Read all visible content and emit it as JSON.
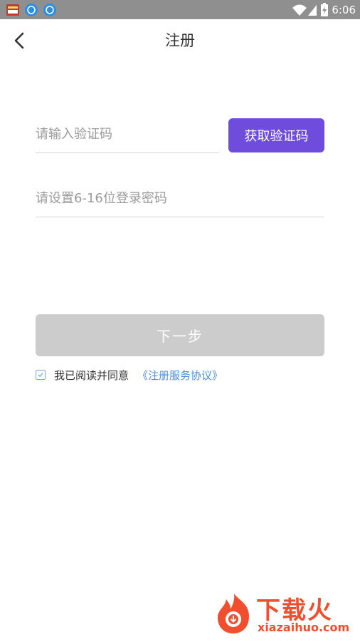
{
  "status_bar": {
    "time": "6:06"
  },
  "header": {
    "title": "注册"
  },
  "form": {
    "code_placeholder": "请输入验证码",
    "get_code_label": "获取验证码",
    "password_placeholder": "请设置6-16位登录密码",
    "next_label": "下一步"
  },
  "agreement": {
    "text": "我已阅读并同意",
    "link": "《注册服务协议》"
  },
  "watermark": {
    "brand": "下载火",
    "domain": "xiazaihuo.com"
  },
  "colors": {
    "accent": "#6f4cdb",
    "disabled_button": "#cccccc",
    "link": "#4a8ee0",
    "watermark": "#ef4f2f"
  },
  "icons": [
    "app-icon-1",
    "app-icon-2",
    "app-icon-3",
    "wifi-icon",
    "signal-icon",
    "battery-icon",
    "back-arrow-icon",
    "checkbox-check-icon"
  ]
}
